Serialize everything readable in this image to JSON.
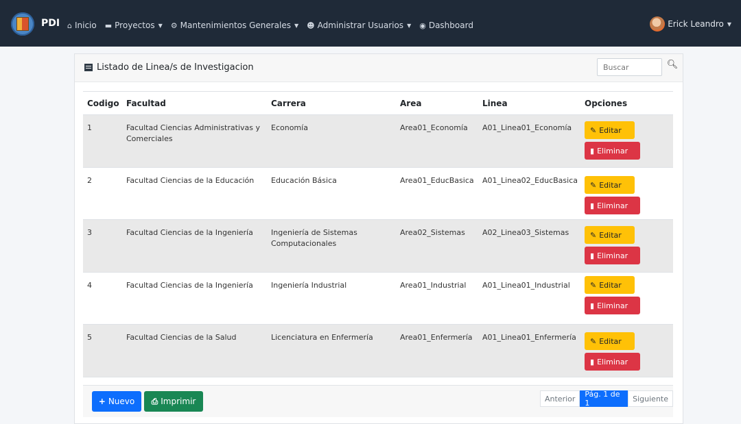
{
  "navbar": {
    "brand": "PDI",
    "items": [
      {
        "label": "Inicio",
        "icon": "home-icon",
        "has_caret": false
      },
      {
        "label": "Proyectos",
        "icon": "folder-icon",
        "has_caret": true
      },
      {
        "label": "Mantenimientos Generales",
        "icon": "cogs-icon",
        "has_caret": true
      },
      {
        "label": "Administrar Usuarios",
        "icon": "users-cog-icon",
        "has_caret": true
      },
      {
        "label": "Dashboard",
        "icon": "dashboard-icon",
        "has_caret": false
      }
    ],
    "user": "Erick Leandro"
  },
  "card": {
    "title": "Listado de Linea/s de Investigacion",
    "search_placeholder": "Buscar"
  },
  "table": {
    "headers": {
      "codigo": "Codigo",
      "facultad": "Facultad",
      "carrera": "Carrera",
      "area": "Area",
      "linea": "Linea",
      "opciones": "Opciones"
    },
    "rows": [
      {
        "codigo": "1",
        "facultad": "Facultad Ciencias Administrativas y Comerciales",
        "carrera": "Economía",
        "area": "Area01_Economía",
        "linea": "A01_Linea01_Economía"
      },
      {
        "codigo": "2",
        "facultad": "Facultad Ciencias de la Educación",
        "carrera": "Educación Básica",
        "area": "Area01_EducBasica",
        "linea": "A01_Linea02_EducBasica"
      },
      {
        "codigo": "3",
        "facultad": "Facultad Ciencias de la Ingeniería",
        "carrera": "Ingeniería de Sistemas Computacionales",
        "area": "Area02_Sistemas",
        "linea": "A02_Linea03_Sistemas"
      },
      {
        "codigo": "4",
        "facultad": "Facultad Ciencias de la Ingeniería",
        "carrera": "Ingeniería Industrial",
        "area": "Area01_Industrial",
        "linea": "A01_Linea01_Industrial"
      },
      {
        "codigo": "5",
        "facultad": "Facultad Ciencias de la Salud",
        "carrera": "Licenciatura en Enfermería",
        "area": "Area01_Enfermería",
        "linea": "A01_Linea01_Enfermería"
      }
    ],
    "edit_label": "Editar",
    "delete_label": "Eliminar"
  },
  "footer": {
    "new_label": "Nuevo",
    "print_label": "Imprimir",
    "pager": {
      "prev": "Anterior",
      "current": "Pág. 1 de 1",
      "next": "Siguiente"
    }
  },
  "colors": {
    "navbar": "#1f2a38",
    "edit": "#ffc107",
    "delete": "#dc3545",
    "primary": "#0d6efd",
    "success": "#198754"
  }
}
